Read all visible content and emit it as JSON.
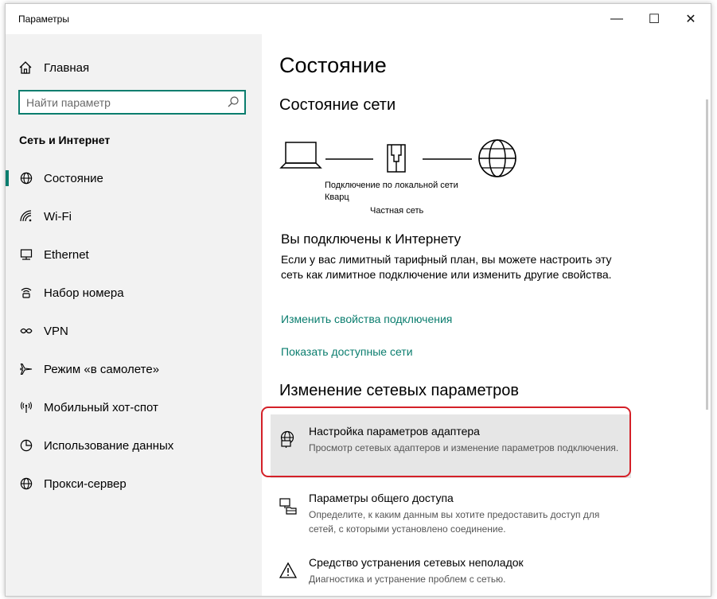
{
  "window": {
    "title": "Параметры",
    "minimize": "—",
    "maximize": "☐",
    "close": "✕"
  },
  "sidebar": {
    "home": "Главная",
    "search_placeholder": "Найти параметр",
    "section": "Сеть и Интернет",
    "items": [
      {
        "label": "Состояние",
        "icon": "globe-icon",
        "active": true
      },
      {
        "label": "Wi-Fi",
        "icon": "wifi-icon"
      },
      {
        "label": "Ethernet",
        "icon": "ethernet-icon"
      },
      {
        "label": "Набор номера",
        "icon": "dialup-icon"
      },
      {
        "label": "VPN",
        "icon": "vpn-icon"
      },
      {
        "label": "Режим «в самолете»",
        "icon": "airplane-icon"
      },
      {
        "label": "Мобильный хот-спот",
        "icon": "hotspot-icon"
      },
      {
        "label": "Использование данных",
        "icon": "data-usage-icon"
      },
      {
        "label": "Прокси-сервер",
        "icon": "proxy-globe-icon"
      }
    ]
  },
  "main": {
    "title": "Состояние",
    "network_status_heading": "Состояние сети",
    "diagram": {
      "connection_name": "Подключение по локальной сети",
      "network_name": "Кварц",
      "network_type": "Частная сеть"
    },
    "connected_heading": "Вы подключены к Интернету",
    "connected_text": "Если у вас лимитный тарифный план, вы можете настроить эту сеть как лимитное подключение или изменить другие свойства.",
    "link_change": "Изменить свойства подключения",
    "link_show": "Показать доступные сети",
    "change_heading": "Изменение сетевых параметров",
    "options": [
      {
        "title": "Настройка параметров адаптера",
        "desc": "Просмотр сетевых адаптеров и изменение параметров подключения.",
        "icon": "adapter-icon",
        "highlighted": true
      },
      {
        "title": "Параметры общего доступа",
        "desc": "Определите, к каким данным вы хотите предоставить доступ для сетей, с которыми установлено соединение.",
        "icon": "sharing-icon"
      },
      {
        "title": "Средство устранения сетевых неполадок",
        "desc": "Диагностика и устранение проблем с сетью.",
        "icon": "warning-icon"
      }
    ]
  },
  "colors": {
    "accent": "#0a7d6e",
    "highlight_frame": "#d42028",
    "sidebar_bg": "#f2f2f2"
  }
}
